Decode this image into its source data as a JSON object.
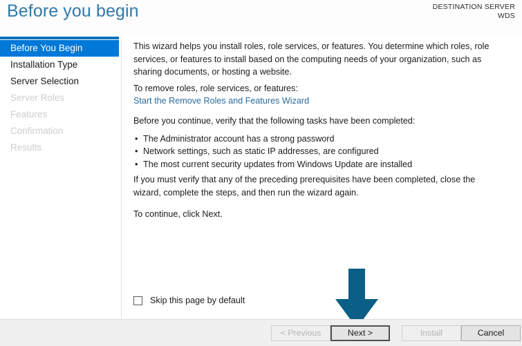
{
  "header": {
    "title": "Before you begin",
    "destination_label": "DESTINATION SERVER",
    "destination_value": "WDS",
    "accent_color": "#0571bf",
    "title_color": "#2e7aa8"
  },
  "sidebar": {
    "items": [
      {
        "label": "Before You Begin",
        "state": "selected"
      },
      {
        "label": "Installation Type",
        "state": "enabled"
      },
      {
        "label": "Server Selection",
        "state": "enabled"
      },
      {
        "label": "Server Roles",
        "state": "disabled"
      },
      {
        "label": "Features",
        "state": "disabled"
      },
      {
        "label": "Confirmation",
        "state": "disabled"
      },
      {
        "label": "Results",
        "state": "disabled"
      }
    ],
    "selected_color": "#0078d7",
    "disabled_color": "#cdcdcd"
  },
  "content": {
    "intro": "This wizard helps you install roles, role services, or features. You determine which roles, role services, or features to install based on the computing needs of your organization, such as sharing documents, or hosting a website.",
    "remove_label": "To remove roles, role services, or features:",
    "remove_link": "Start the Remove Roles and Features Wizard",
    "remove_link_color": "#2a6b9e",
    "verify_label": "Before you continue, verify that the following tasks have been completed:",
    "bullet_glyph": "•",
    "bullets": [
      "The Administrator account has a strong password",
      "Network settings, such as static IP addresses, are configured",
      "The most current security updates from Windows Update are installed"
    ],
    "prereq": "If you must verify that any of the preceding prerequisites have been completed, close the wizard, complete the steps, and then run the wizard again.",
    "continue": "To continue, click Next."
  },
  "skip": {
    "label": "Skip this page by default",
    "checked": false
  },
  "annotation": {
    "arrow_direction": "down",
    "arrow_color": "#0b5e85",
    "points_at": "Next >"
  },
  "footer": {
    "buttons": [
      {
        "label": "< Previous",
        "state": "disabled"
      },
      {
        "label": "Next >",
        "state": "focused"
      },
      {
        "label": "Install",
        "state": "disabled"
      },
      {
        "label": "Cancel",
        "state": "enabled"
      }
    ]
  }
}
